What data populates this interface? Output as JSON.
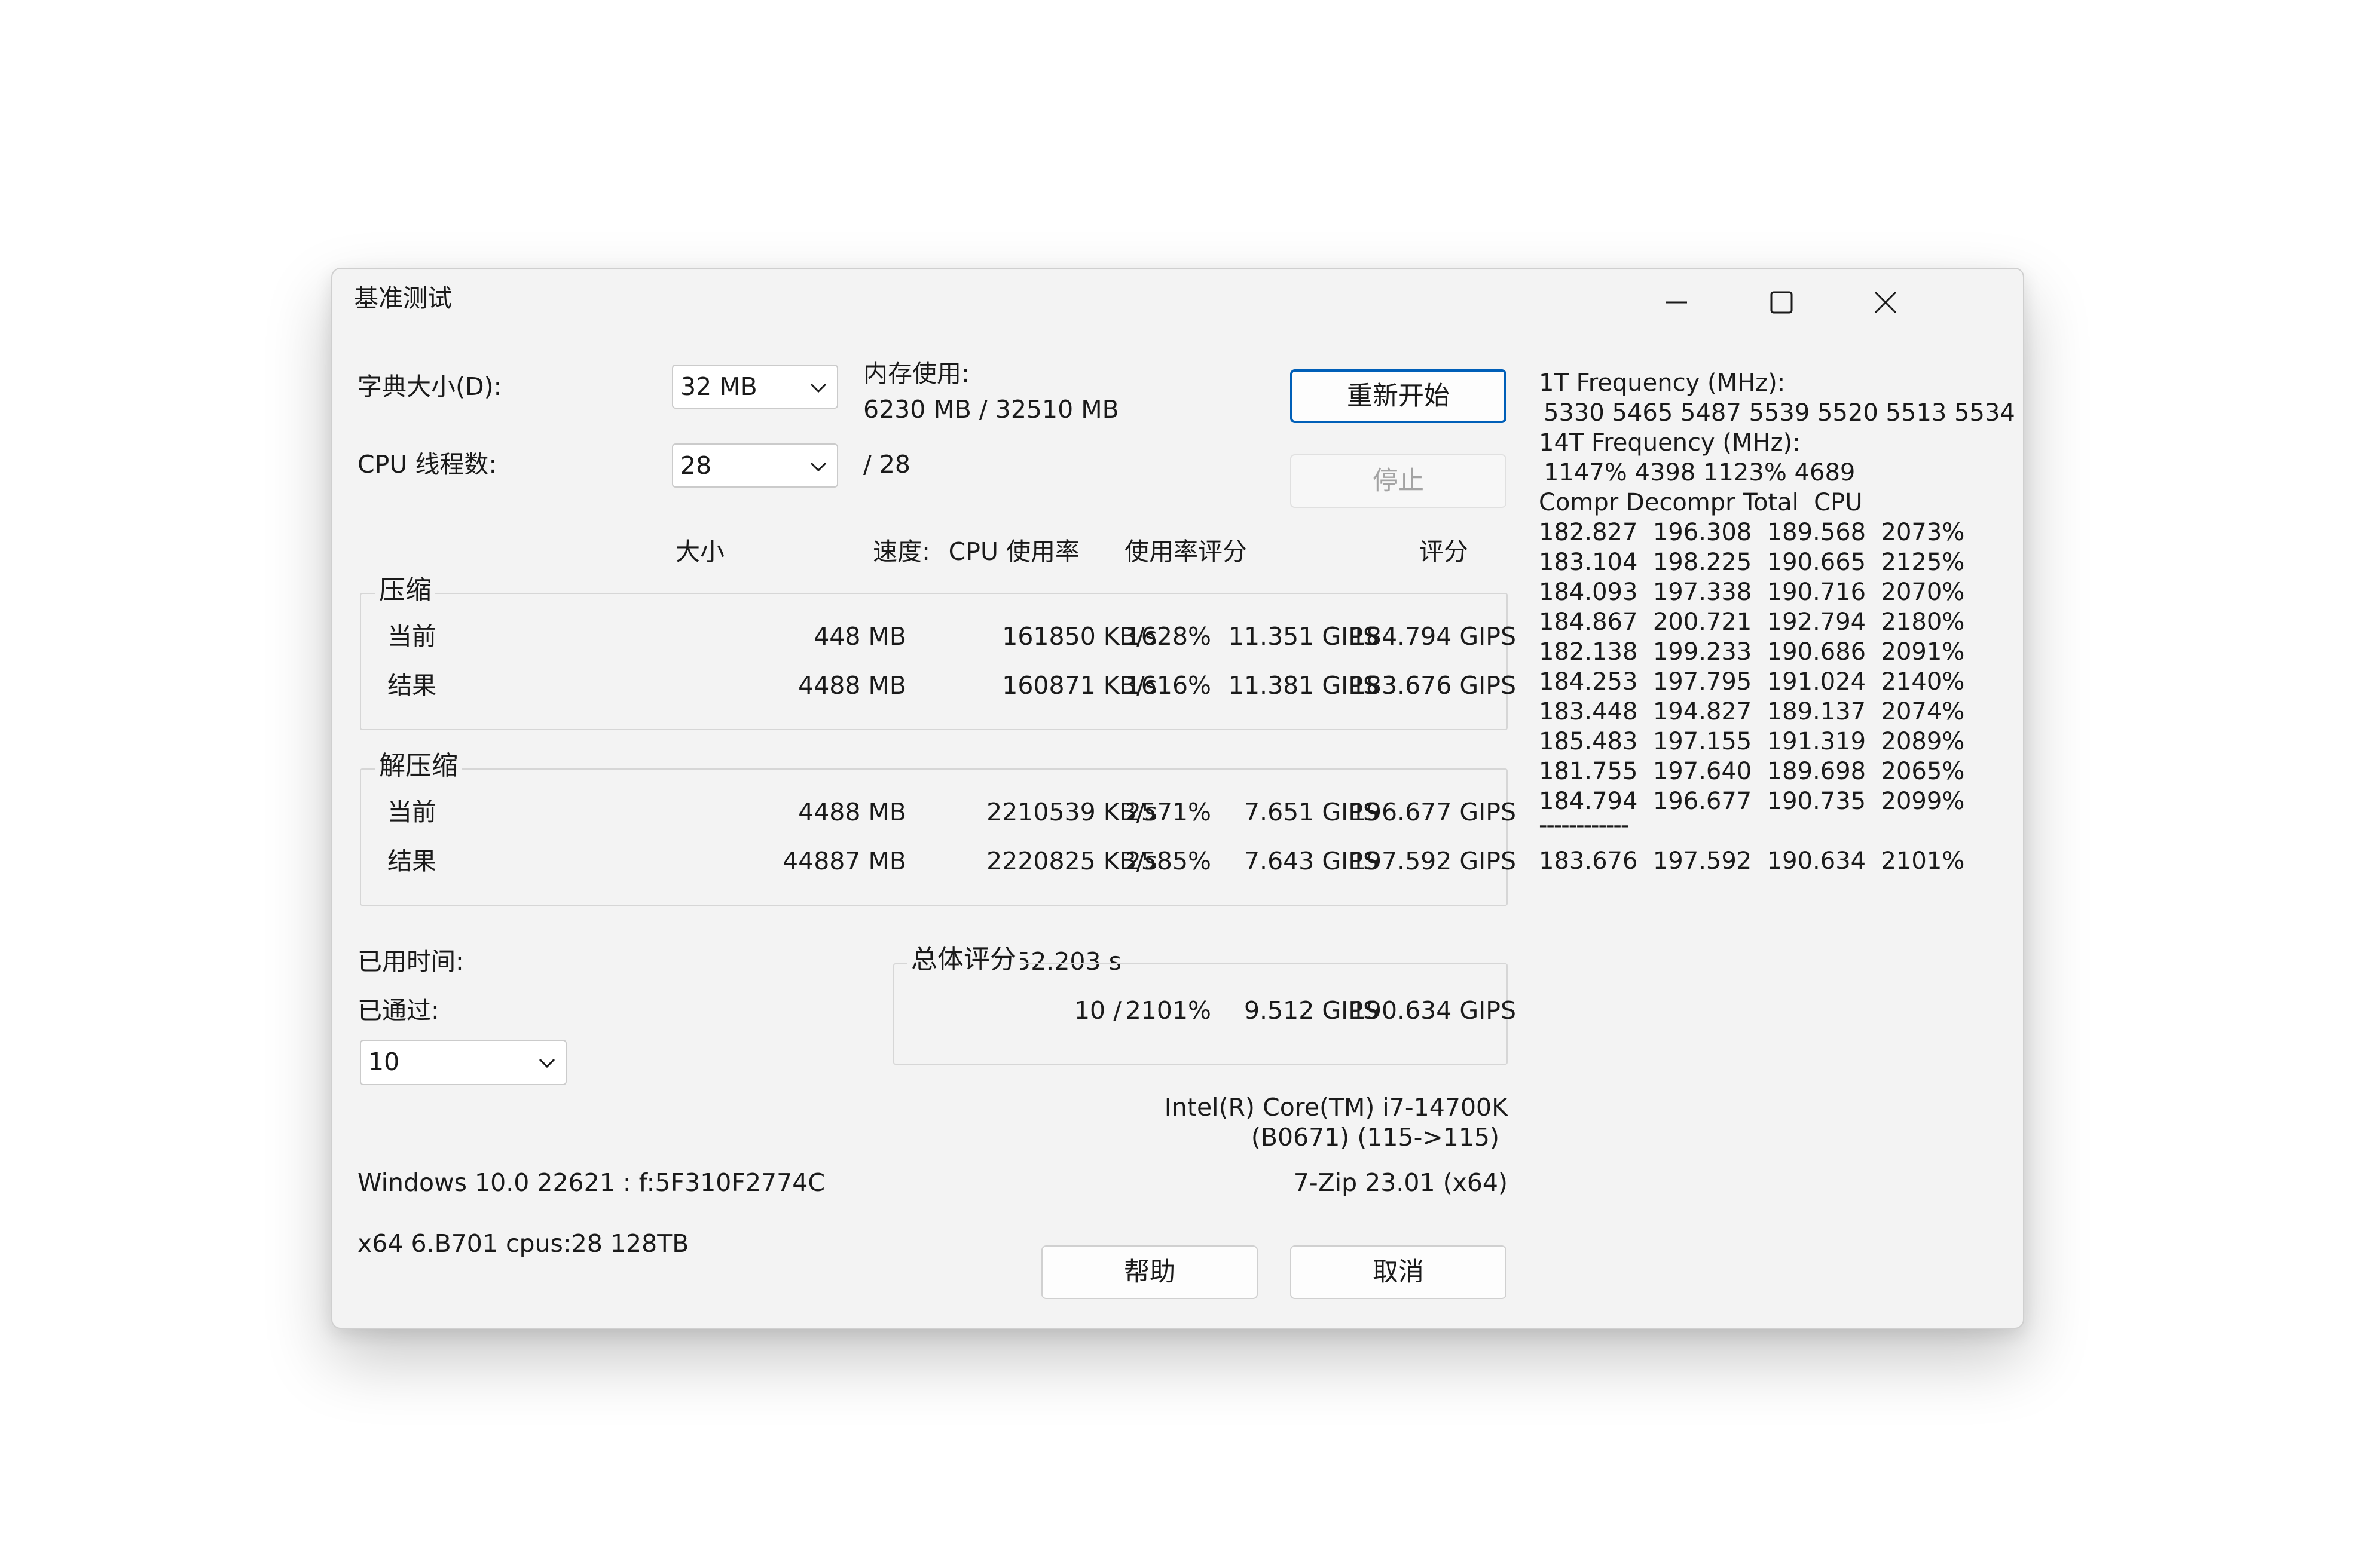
{
  "window": {
    "title": "基准测试",
    "controls": [
      "minimize-icon",
      "maximize-icon",
      "close-icon"
    ]
  },
  "settings": {
    "dict_label": "字典大小(D):",
    "dict_value": "32 MB",
    "threads_label": "CPU 线程数:",
    "threads_value": "28",
    "threads_max": "/ 28",
    "memory_label": "内存使用:",
    "memory_value": "6230 MB / 32510 MB"
  },
  "buttons": {
    "restart": "重新开始",
    "stop": "停止",
    "help": "帮助",
    "cancel": "取消"
  },
  "table": {
    "headers": [
      "大小",
      "速度:",
      "CPU 使用率",
      "使用率评分",
      "评分"
    ],
    "compress": {
      "legend": "压缩",
      "rows": [
        {
          "label": "当前",
          "size": "448 MB",
          "speed": "161850 KB/s",
          "cpu": "1628%",
          "rating_usage": "11.351 GIPS",
          "rating": "184.794 GIPS"
        },
        {
          "label": "结果",
          "size": "4488 MB",
          "speed": "160871 KB/s",
          "cpu": "1616%",
          "rating_usage": "11.381 GIPS",
          "rating": "183.676 GIPS"
        }
      ]
    },
    "decompress": {
      "legend": "解压缩",
      "rows": [
        {
          "label": "当前",
          "size": "4488 MB",
          "speed": "2210539 KB/s",
          "cpu": "2571%",
          "rating_usage": "7.651 GIPS",
          "rating": "196.677 GIPS"
        },
        {
          "label": "结果",
          "size": "44887 MB",
          "speed": "2220825 KB/s",
          "cpu": "2585%",
          "rating_usage": "7.643 GIPS",
          "rating": "197.592 GIPS"
        }
      ]
    }
  },
  "stats": {
    "elapsed_label": "已用时间:",
    "elapsed_value": "52.203 s",
    "passed_label": "已通过:",
    "passed_value": "10 /",
    "passes_select": "10"
  },
  "total": {
    "legend": "总体评分",
    "cpu": "2101%",
    "rating_usage": "9.512 GIPS",
    "rating": "190.634 GIPS"
  },
  "system": {
    "cpu_name": "Intel(R) Core(TM) i7-14700K",
    "cpu_id": "(B0671) (115->115)",
    "os": "Windows 10.0 22621 : f:5F310F2774C",
    "arch": "x64 6.B701 cpus:28 128TB",
    "version": "7-Zip 23.01 (x64)"
  },
  "log": {
    "freq1_label": "1T Frequency (MHz):",
    "freq1_values": "5330 5465 5487 5539 5520 5513 5534",
    "freq14_label": "14T Frequency (MHz):",
    "freq14_values": "1147% 4398 1123% 4689",
    "columns_header": "Compr Decompr Total  CPU",
    "rows": [
      "182.827  196.308  189.568  2073%",
      "183.104  198.225  190.665  2125%",
      "184.093  197.338  190.716  2070%",
      "184.867  200.721  192.794  2180%",
      "182.138  199.233  190.686  2091%",
      "184.253  197.795  191.024  2140%",
      "183.448  194.827  189.137  2074%",
      "185.483  197.155  191.319  2089%",
      "181.755  197.640  189.698  2065%",
      "184.794  196.677  190.735  2099%"
    ],
    "separator": "------------",
    "summary": "183.676  197.592  190.634  2101%"
  }
}
